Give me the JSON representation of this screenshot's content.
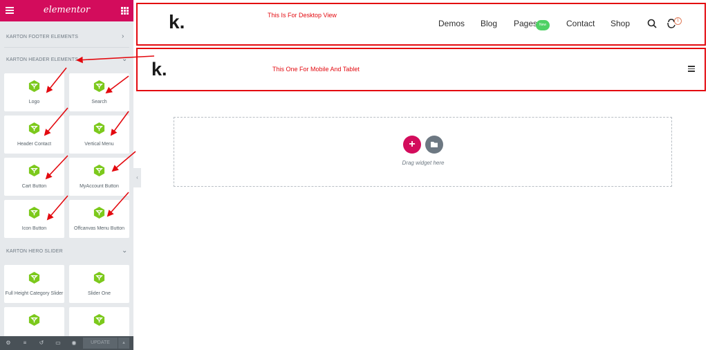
{
  "sidebar": {
    "brand": "elementor",
    "categories": {
      "footer": "KARTON FOOTER ELEMENTS",
      "header": "KARTON HEADER ELEMENTS",
      "hero": "KARTON HERO SLIDER"
    },
    "widgets": {
      "logo": "Logo",
      "search": "Search",
      "header_contact": "Header Contact",
      "vertical_menu": "Vertical Menu",
      "cart_button": "Cart Button",
      "myaccount_button": "MyAccount Button",
      "icon_button": "Icon Button",
      "offcanvas_button": "Offcanvas Menu Button",
      "full_height_slider": "Full Height Category Slider",
      "slider_one": "Slider One"
    },
    "footer": {
      "update_label": "UPDATE"
    }
  },
  "desktop_header": {
    "logo": "k.",
    "note": "This Is For Desktop View",
    "nav": {
      "demos": "Demos",
      "blog": "Blog",
      "pages": "Pages",
      "new_badge": "New",
      "contact": "Contact",
      "shop": "Shop"
    },
    "cart_count": "1"
  },
  "mobile_header": {
    "logo": "k.",
    "note": "This One For Mobile And Tablet"
  },
  "canvas": {
    "drop_text": "Drag widget here"
  },
  "colors": {
    "accent": "#d30c5c",
    "annotation": "#e3090f",
    "widget_icon": "#7cc91c",
    "new_badge": "#4ed164"
  }
}
